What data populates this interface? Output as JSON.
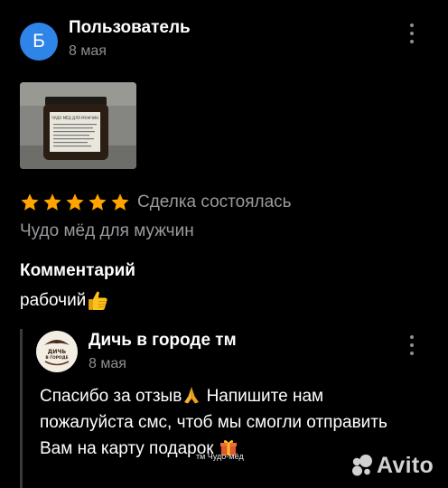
{
  "review": {
    "author": {
      "avatar_letter": "Б",
      "avatar_color": "#2f84e8",
      "name": "Пользователь",
      "date": "8 мая"
    },
    "menu_icon": "more-vertical-icon",
    "photo": {
      "label_lines": [
        "ЧУДО МЁД ДЛЯ МУЖЧИН"
      ]
    },
    "rating": 5,
    "rating_max": 5,
    "star_color": "#ffa400",
    "deal_status": "Сделка состоялась",
    "product": "Чудо мёд для мужчин",
    "comment_heading": "Комментарий",
    "comment_text": "рабочий",
    "comment_emoji": "thumbs-up-icon"
  },
  "reply": {
    "seller": {
      "logo_lines": [
        "ДИЧЬ",
        "В ГОРОДЕ"
      ],
      "name": "Дичь в городе тм",
      "date": "8 мая"
    },
    "menu_icon": "more-vertical-icon",
    "text_part1": "Спасибо за отзыв",
    "emoji1": "folded-hands-icon",
    "text_part2": " Напишите нам пожалуйста смс, чтоб мы смогли отправить Вам на карту подарок ",
    "emoji2": "gift-icon"
  },
  "watermark": "тм Чудо-мёд",
  "avito": {
    "wordmark": "Avito"
  }
}
